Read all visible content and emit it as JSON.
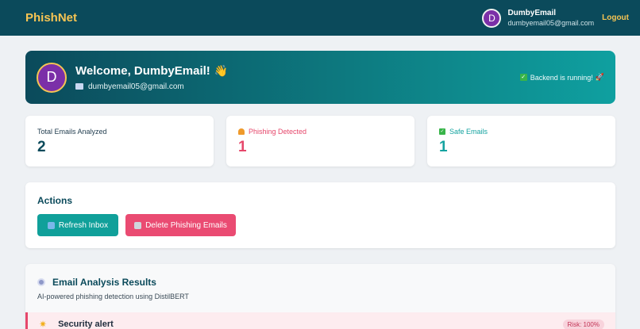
{
  "navbar": {
    "brand": "PhishNet",
    "avatar_letter": "D",
    "user_name": "DumbyEmail",
    "user_email": "dumbyemail05@gmail.com",
    "logout_label": "Logout"
  },
  "welcome": {
    "avatar_letter": "D",
    "title": "Welcome, DumbyEmail!",
    "wave": "👋",
    "email": "dumbyemail05@gmail.com",
    "backend_status": "Backend is running! ",
    "rocket": "🚀"
  },
  "stats": [
    {
      "label": "Total Emails Analyzed",
      "value": "2"
    },
    {
      "label": "Phishing Detected",
      "value": "1"
    },
    {
      "label": "Safe Emails",
      "value": "1"
    }
  ],
  "actions": {
    "title": "Actions",
    "refresh_label": "Refresh Inbox",
    "delete_label": "Delete Phishing Emails"
  },
  "results": {
    "title": "Email Analysis Results",
    "subtitle": "AI-powered phishing detection using DistilBERT",
    "first_subject": "Security alert",
    "first_risk": "Risk: 100%"
  },
  "colors": {
    "navbar": "#0b4a5b",
    "brand": "#f6c453",
    "phishing": "#e6476b",
    "safe": "#14a3a0",
    "refresh_button": "#10a09a",
    "delete_button": "#ea4b72"
  }
}
